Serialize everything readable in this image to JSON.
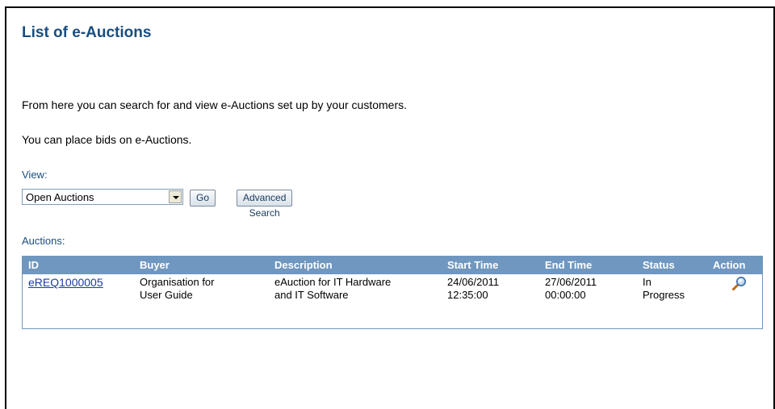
{
  "page": {
    "title": "List of e-Auctions",
    "intro_line_1": "From here you can search for and view e-Auctions set up by your customers.",
    "intro_line_2": "You can place bids on e-Auctions."
  },
  "view": {
    "label": "View:",
    "selected": "Open Auctions",
    "go_label": "Go",
    "advanced_search_label": "Advanced Search"
  },
  "auctions": {
    "label": "Auctions:",
    "columns": {
      "id": "ID",
      "buyer": "Buyer",
      "description": "Description",
      "start_time": "Start Time",
      "end_time": "End Time",
      "status": "Status",
      "action": "Action"
    },
    "rows": [
      {
        "id": "eREQ1000005",
        "buyer_line_1": "Organisation for",
        "buyer_line_2": "User Guide",
        "description_line_1": "eAuction for IT Hardware",
        "description_line_2": "and IT Software",
        "start_date": "24/06/2011",
        "start_clock": "12:35:00",
        "end_date": "27/06/2011",
        "end_clock": "00:00:00",
        "status_line_1": "In",
        "status_line_2": "Progress",
        "action_icon": "magnifier-icon"
      }
    ]
  },
  "colors": {
    "title": "#1a4d80",
    "table_header": "#6f97c0",
    "link": "#1a3f9c"
  }
}
